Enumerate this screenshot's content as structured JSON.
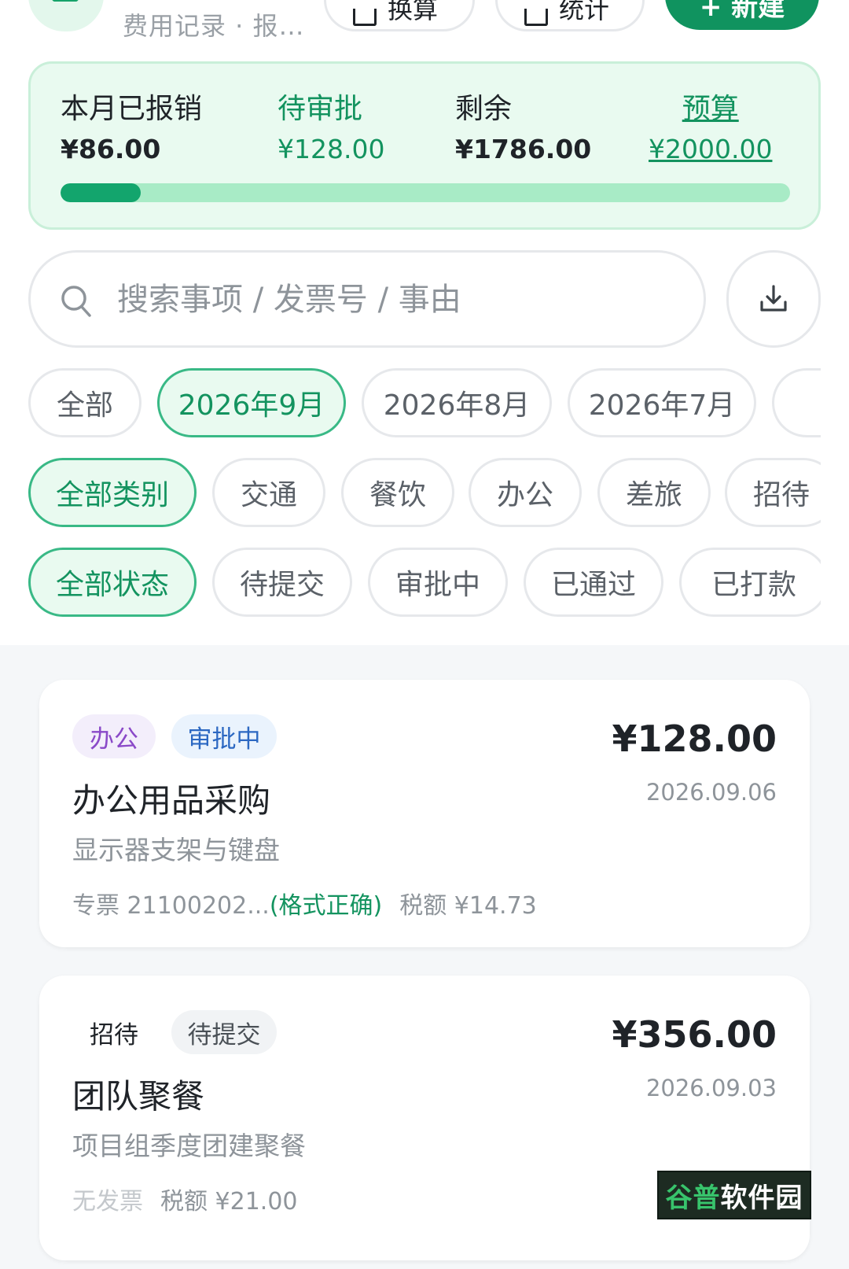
{
  "header": {
    "subtitle": "费用记录 · 报…",
    "calc_label": "换算",
    "stats_label": "统计",
    "new_label": "+ 新建"
  },
  "budget": {
    "reimbursed_label": "本月已报销",
    "reimbursed_value": "¥86.00",
    "pending_label": "待审批",
    "pending_value": "¥128.00",
    "remaining_label": "剩余",
    "remaining_value": "¥1786.00",
    "budget_label": "预算",
    "budget_value": "¥2000.00",
    "progress_fraction": 0.11
  },
  "search": {
    "placeholder": "搜索事项 / 发票号 / 事由",
    "value": ""
  },
  "filters": {
    "months": [
      "全部",
      "2026年9月",
      "2026年8月",
      "2026年7月",
      ""
    ],
    "months_active": 1,
    "categories": [
      "全部类别",
      "交通",
      "餐饮",
      "办公",
      "差旅",
      "招待"
    ],
    "categories_active": 0,
    "statuses": [
      "全部状态",
      "待提交",
      "审批中",
      "已通过",
      "已打款"
    ],
    "statuses_active": 0
  },
  "records": [
    {
      "category": "办公",
      "status": "审批中",
      "title": "办公用品采购",
      "description": "显示器支架与键盘",
      "invoice": "专票 21100202...",
      "invoice_check": "(格式正确)",
      "tax": "税额 ¥14.73",
      "amount": "¥128.00",
      "date": "2026.09.06"
    },
    {
      "category": "招待",
      "status": "待提交",
      "title": "团队聚餐",
      "description": "项目组季度团建聚餐",
      "invoice": "无发票",
      "invoice_check": "",
      "tax": "税额 ¥21.00",
      "amount": "¥356.00",
      "date": "2026.09.03"
    }
  ],
  "watermark": {
    "accent": "谷普",
    "text": "软件园"
  },
  "colors": {
    "accent_green": "#13935f",
    "budget_bg": "#e9faf0",
    "progress_fill": "#13a56d",
    "progress_track": "#a8ebc6",
    "status_blue": "#2c68c2",
    "category_purple": "#8a49c8"
  },
  "icons": {
    "app": "ledger-icon",
    "search": "search-icon",
    "download": "download-icon",
    "calc": "calculator-icon",
    "stats": "chart-icon"
  }
}
